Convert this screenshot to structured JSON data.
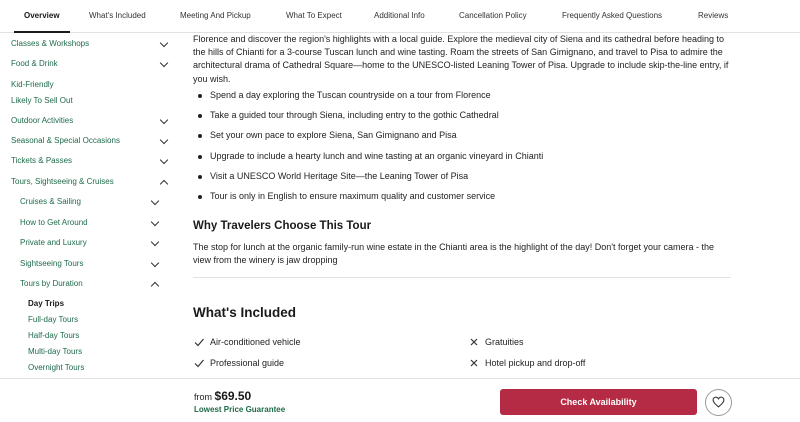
{
  "tabs": [
    {
      "label": "Overview",
      "active": true
    },
    {
      "label": "What's Included"
    },
    {
      "label": "Meeting And Pickup"
    },
    {
      "label": "What To Expect"
    },
    {
      "label": "Additional Info"
    },
    {
      "label": "Cancellation Policy"
    },
    {
      "label": "Frequently Asked Questions"
    },
    {
      "label": "Reviews"
    }
  ],
  "sidebar": {
    "items": [
      {
        "label": "Classes & Workshops",
        "chevron": "down"
      },
      {
        "label": "Food & Drink",
        "chevron": "down"
      },
      {
        "label": "Kid-Friendly"
      },
      {
        "label": "Likely To Sell Out"
      },
      {
        "label": "Outdoor Activities",
        "chevron": "down"
      },
      {
        "label": "Seasonal & Special Occasions",
        "chevron": "down"
      },
      {
        "label": "Tickets & Passes",
        "chevron": "down"
      },
      {
        "label": "Tours, Sightseeing & Cruises",
        "chevron": "up"
      },
      {
        "label": "Cruises & Sailing",
        "chevron": "down"
      },
      {
        "label": "How to Get Around",
        "chevron": "down"
      },
      {
        "label": "Private and Luxury",
        "chevron": "down"
      },
      {
        "label": "Sightseeing Tours",
        "chevron": "down"
      },
      {
        "label": "Tours by Duration",
        "chevron": "up"
      },
      {
        "label": "Day Trips",
        "active": true
      },
      {
        "label": "Full-day Tours"
      },
      {
        "label": "Half-day Tours"
      },
      {
        "label": "Multi-day Tours"
      },
      {
        "label": "Overnight Tours"
      }
    ]
  },
  "overview": {
    "intro": "Florence and discover the region's highlights with a local guide. Explore the medieval city of Siena and its cathedral before heading to the hills of Chianti for a 3-course Tuscan lunch and wine tasting. Roam the streets of San Gimignano, and travel to Pisa to admire the architectural drama of Cathedral Square—home to the UNESCO-listed Leaning Tower of Pisa. Upgrade to include skip-the-line entry, if you wish.",
    "highlights": [
      "Spend a day exploring the Tuscan countryside on a tour from Florence",
      "Take a guided tour through Siena, including entry to the gothic Cathedral",
      "Set your own pace to explore Siena, San Gimignano and Pisa",
      "Upgrade to include a hearty lunch and wine tasting at an organic vineyard in Chianti",
      "Visit a UNESCO World Heritage Site—the Leaning Tower of Pisa",
      "Tour is only in English to ensure maximum quality and customer service"
    ],
    "why_heading": "Why Travelers Choose This Tour",
    "why_text": "The stop for lunch at the organic family-run wine estate in the Chianti area is the highlight of the day! Don't forget your camera - the view from the winery is jaw dropping"
  },
  "included": {
    "heading": "What's Included",
    "included_items": [
      "Air-conditioned vehicle",
      "Professional guide"
    ],
    "excluded_items": [
      "Gratuities",
      "Hotel pickup and drop-off"
    ]
  },
  "footer": {
    "price_prefix": "from",
    "price": "$69.50",
    "guarantee": "Lowest Price Guarantee",
    "cta_label": "Check Availability"
  },
  "colors": {
    "accent_green": "#1f6b4a",
    "cta_red": "#b52a44"
  },
  "icons": {
    "check": "check-icon",
    "cross": "x-icon",
    "heart": "heart-icon",
    "chevron_down": "chevron-down-icon",
    "chevron_up": "chevron-up-icon"
  }
}
